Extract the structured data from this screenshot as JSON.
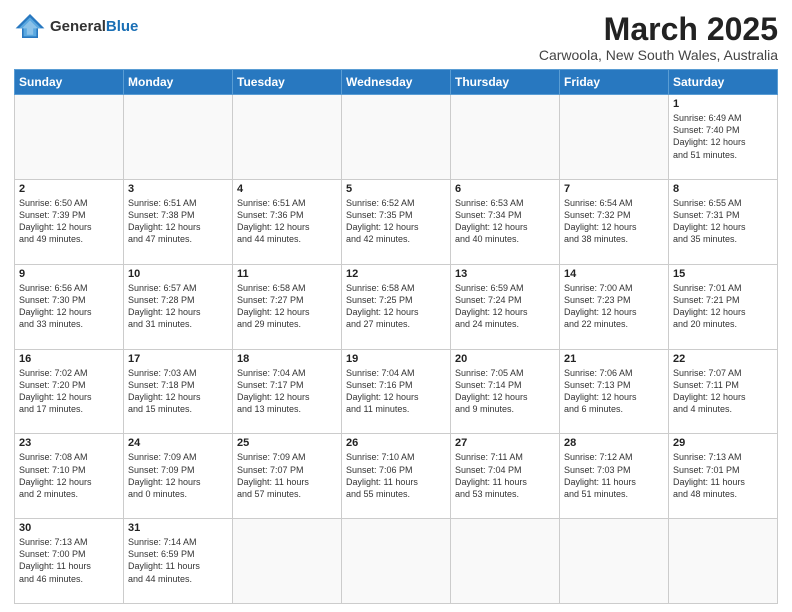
{
  "header": {
    "logo_general": "General",
    "logo_blue": "Blue",
    "month_title": "March 2025",
    "location": "Carwoola, New South Wales, Australia"
  },
  "days_of_week": [
    "Sunday",
    "Monday",
    "Tuesday",
    "Wednesday",
    "Thursday",
    "Friday",
    "Saturday"
  ],
  "weeks": [
    [
      {
        "day": "",
        "info": ""
      },
      {
        "day": "",
        "info": ""
      },
      {
        "day": "",
        "info": ""
      },
      {
        "day": "",
        "info": ""
      },
      {
        "day": "",
        "info": ""
      },
      {
        "day": "",
        "info": ""
      },
      {
        "day": "1",
        "info": "Sunrise: 6:49 AM\nSunset: 7:40 PM\nDaylight: 12 hours\nand 51 minutes."
      }
    ],
    [
      {
        "day": "2",
        "info": "Sunrise: 6:50 AM\nSunset: 7:39 PM\nDaylight: 12 hours\nand 49 minutes."
      },
      {
        "day": "3",
        "info": "Sunrise: 6:51 AM\nSunset: 7:38 PM\nDaylight: 12 hours\nand 47 minutes."
      },
      {
        "day": "4",
        "info": "Sunrise: 6:51 AM\nSunset: 7:36 PM\nDaylight: 12 hours\nand 44 minutes."
      },
      {
        "day": "5",
        "info": "Sunrise: 6:52 AM\nSunset: 7:35 PM\nDaylight: 12 hours\nand 42 minutes."
      },
      {
        "day": "6",
        "info": "Sunrise: 6:53 AM\nSunset: 7:34 PM\nDaylight: 12 hours\nand 40 minutes."
      },
      {
        "day": "7",
        "info": "Sunrise: 6:54 AM\nSunset: 7:32 PM\nDaylight: 12 hours\nand 38 minutes."
      },
      {
        "day": "8",
        "info": "Sunrise: 6:55 AM\nSunset: 7:31 PM\nDaylight: 12 hours\nand 35 minutes."
      }
    ],
    [
      {
        "day": "9",
        "info": "Sunrise: 6:56 AM\nSunset: 7:30 PM\nDaylight: 12 hours\nand 33 minutes."
      },
      {
        "day": "10",
        "info": "Sunrise: 6:57 AM\nSunset: 7:28 PM\nDaylight: 12 hours\nand 31 minutes."
      },
      {
        "day": "11",
        "info": "Sunrise: 6:58 AM\nSunset: 7:27 PM\nDaylight: 12 hours\nand 29 minutes."
      },
      {
        "day": "12",
        "info": "Sunrise: 6:58 AM\nSunset: 7:25 PM\nDaylight: 12 hours\nand 27 minutes."
      },
      {
        "day": "13",
        "info": "Sunrise: 6:59 AM\nSunset: 7:24 PM\nDaylight: 12 hours\nand 24 minutes."
      },
      {
        "day": "14",
        "info": "Sunrise: 7:00 AM\nSunset: 7:23 PM\nDaylight: 12 hours\nand 22 minutes."
      },
      {
        "day": "15",
        "info": "Sunrise: 7:01 AM\nSunset: 7:21 PM\nDaylight: 12 hours\nand 20 minutes."
      }
    ],
    [
      {
        "day": "16",
        "info": "Sunrise: 7:02 AM\nSunset: 7:20 PM\nDaylight: 12 hours\nand 17 minutes."
      },
      {
        "day": "17",
        "info": "Sunrise: 7:03 AM\nSunset: 7:18 PM\nDaylight: 12 hours\nand 15 minutes."
      },
      {
        "day": "18",
        "info": "Sunrise: 7:04 AM\nSunset: 7:17 PM\nDaylight: 12 hours\nand 13 minutes."
      },
      {
        "day": "19",
        "info": "Sunrise: 7:04 AM\nSunset: 7:16 PM\nDaylight: 12 hours\nand 11 minutes."
      },
      {
        "day": "20",
        "info": "Sunrise: 7:05 AM\nSunset: 7:14 PM\nDaylight: 12 hours\nand 9 minutes."
      },
      {
        "day": "21",
        "info": "Sunrise: 7:06 AM\nSunset: 7:13 PM\nDaylight: 12 hours\nand 6 minutes."
      },
      {
        "day": "22",
        "info": "Sunrise: 7:07 AM\nSunset: 7:11 PM\nDaylight: 12 hours\nand 4 minutes."
      }
    ],
    [
      {
        "day": "23",
        "info": "Sunrise: 7:08 AM\nSunset: 7:10 PM\nDaylight: 12 hours\nand 2 minutes."
      },
      {
        "day": "24",
        "info": "Sunrise: 7:09 AM\nSunset: 7:09 PM\nDaylight: 12 hours\nand 0 minutes."
      },
      {
        "day": "25",
        "info": "Sunrise: 7:09 AM\nSunset: 7:07 PM\nDaylight: 11 hours\nand 57 minutes."
      },
      {
        "day": "26",
        "info": "Sunrise: 7:10 AM\nSunset: 7:06 PM\nDaylight: 11 hours\nand 55 minutes."
      },
      {
        "day": "27",
        "info": "Sunrise: 7:11 AM\nSunset: 7:04 PM\nDaylight: 11 hours\nand 53 minutes."
      },
      {
        "day": "28",
        "info": "Sunrise: 7:12 AM\nSunset: 7:03 PM\nDaylight: 11 hours\nand 51 minutes."
      },
      {
        "day": "29",
        "info": "Sunrise: 7:13 AM\nSunset: 7:01 PM\nDaylight: 11 hours\nand 48 minutes."
      }
    ],
    [
      {
        "day": "30",
        "info": "Sunrise: 7:13 AM\nSunset: 7:00 PM\nDaylight: 11 hours\nand 46 minutes."
      },
      {
        "day": "31",
        "info": "Sunrise: 7:14 AM\nSunset: 6:59 PM\nDaylight: 11 hours\nand 44 minutes."
      },
      {
        "day": "",
        "info": ""
      },
      {
        "day": "",
        "info": ""
      },
      {
        "day": "",
        "info": ""
      },
      {
        "day": "",
        "info": ""
      },
      {
        "day": "",
        "info": ""
      }
    ]
  ]
}
